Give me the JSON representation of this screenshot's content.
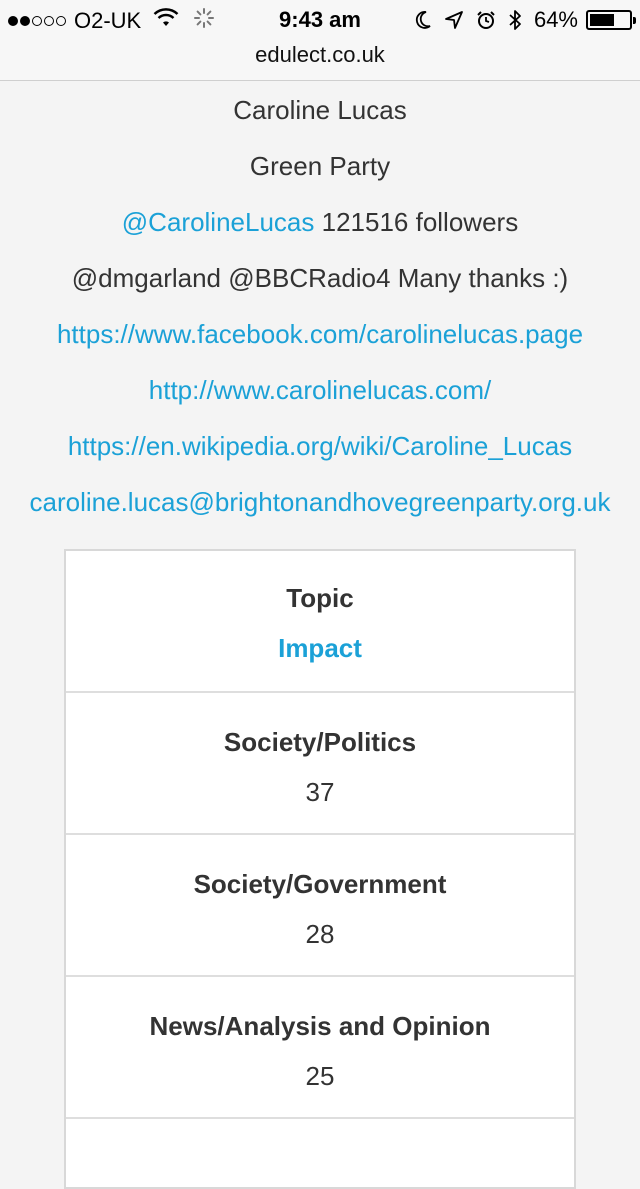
{
  "status_bar": {
    "carrier": "O2-UK",
    "time": "9:43 am",
    "battery": "64%",
    "battery_level": 0.64,
    "signal_bars_filled": 2,
    "signal_bars_total": 5,
    "icons": [
      "wifi-icon",
      "loading-spinner-icon",
      "moon-icon",
      "location-arrow-icon",
      "alarm-icon",
      "bluetooth-icon",
      "battery-icon"
    ]
  },
  "browser": {
    "url": "edulect.co.uk"
  },
  "profile": {
    "name": "Caroline Lucas",
    "party": "Green Party",
    "twitter_handle": "@CarolineLucas",
    "followers_text": " 121516 followers",
    "latest_tweet": "@dmgarland @BBCRadio4 Many thanks :)",
    "facebook_url": "https://www.facebook.com/carolinelucas.page",
    "website_url": "http://www.carolinelucas.com/",
    "wikipedia_url": "https://en.wikipedia.org/wiki/Caroline_Lucas",
    "email": "caroline.lucas@brightonandhovegreenparty.org.uk"
  },
  "topics_table": {
    "header_label": "Topic",
    "header_sort": "Impact",
    "rows": [
      {
        "topic": "Society/Politics",
        "impact": "37"
      },
      {
        "topic": "Society/Government",
        "impact": "28"
      },
      {
        "topic": "News/Analysis and Opinion",
        "impact": "25"
      }
    ]
  },
  "colors": {
    "link": "#1ba1d7",
    "text": "#333333",
    "background": "#f4f4f4"
  }
}
